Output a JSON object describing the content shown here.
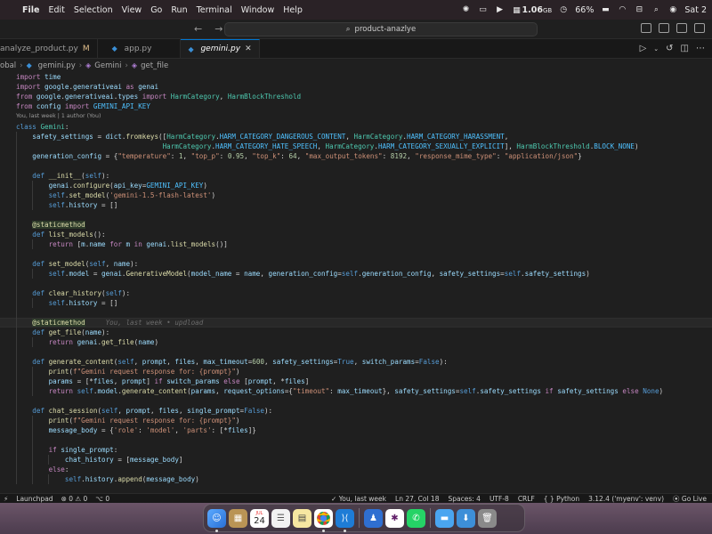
{
  "menubar": {
    "app": "File",
    "items": [
      "Edit",
      "Selection",
      "View",
      "Go",
      "Run",
      "Terminal",
      "Window",
      "Help"
    ],
    "memory": "1.06",
    "memory_unit": "GB",
    "battery": "66%",
    "clock": "Sat 2"
  },
  "window": {
    "search_text": "product-anazlye"
  },
  "tabs": [
    {
      "label": "analyze_product.py",
      "modified": "M",
      "active": false
    },
    {
      "label": "app.py",
      "modified": "",
      "active": false
    },
    {
      "label": "gemini.py",
      "modified": "",
      "active": true
    }
  ],
  "breadcrumb": {
    "root": "obal",
    "file": "gemini.py",
    "class": "Gemini",
    "method": "get_file"
  },
  "editor": {
    "lines": [
      "import time",
      "import google.generativeai as genai",
      "from google.generativeai.types import HarmCategory, HarmBlockThreshold",
      "from config import GEMINI_API_KEY",
      "class Gemini:",
      "    safety_settings = dict.fromkeys([HarmCategory.HARM_CATEGORY_DANGEROUS_CONTENT, HarmCategory.HARM_CATEGORY_HARASSMENT,",
      "                                    HarmCategory.HARM_CATEGORY_HATE_SPEECH, HarmCategory.HARM_CATEGORY_SEXUALLY_EXPLICIT], HarmBlockThreshold.BLOCK_NONE)",
      "    generation_config = {\"temperature\": 1, \"top_p\": 0.95, \"top_k\": 64, \"max_output_tokens\": 8192, \"response_mime_type\": \"application/json\"}",
      "",
      "    def __init__(self):",
      "        genai.configure(api_key=GEMINI_API_KEY)",
      "        self.set_model('gemini-1.5-flash-latest')",
      "        self.history = []",
      "",
      "    @staticmethod",
      "    def list_models():",
      "        return [m.name for m in genai.list_models()]",
      "",
      "    def set_model(self, name):",
      "        self.model = genai.GenerativeModel(model_name = name, generation_config=self.generation_config, safety_settings=self.safety_settings)",
      "",
      "    def clear_history(self):",
      "        self.history = []",
      "",
      "    @staticmethod",
      "    def get_file(name):",
      "        return genai.get_file(name)",
      "",
      "    def generate_content(self, prompt, files, max_timeout=600, safety_settings=True, switch_params=False):",
      "        print(f\"Gemini request response for: {prompt}\")",
      "        params = [*files, prompt] if switch_params else [prompt, *files]",
      "        return self.model.generate_content(params, request_options={\"timeout\": max_timeout}, safety_settings=self.safety_settings if safety_settings else None)",
      "",
      "    def chat_session(self, prompt, files, single_prompt=False):",
      "        print(f\"Gemini request response for: {prompt}\")",
      "        message_body = {'role': 'model', 'parts': [*files]}",
      "",
      "        if single_prompt:",
      "            chat_history = [message_body]",
      "        else:",
      "            self.history.append(message_body)"
    ],
    "codelens_class": "You, last week | 1 author (You)",
    "inline_blame": "You, last week • updload"
  },
  "statusbar": {
    "left": [
      "Launchpad",
      "0",
      "0",
      "0"
    ],
    "git_blame": "You, last week",
    "cursor": "Ln 27, Col 18",
    "spaces": "Spaces: 4",
    "encoding": "UTF-8",
    "eol": "CRLF",
    "language": "Python",
    "interpreter": "3.12.4 ('myenv': venv)",
    "golive": "Go Live"
  },
  "dock": {
    "calendar_month": "JUL",
    "calendar_day": "24"
  }
}
